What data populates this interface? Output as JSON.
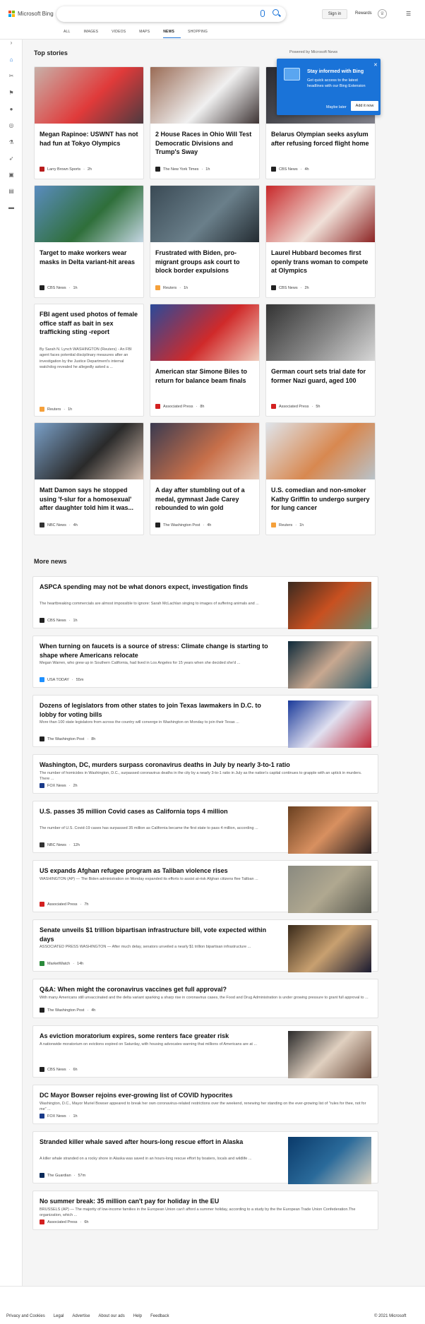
{
  "header": {
    "logo_text": "Microsoft Bing",
    "signin": "Sign in",
    "rewards": "Rewards",
    "tabs": [
      "ALL",
      "IMAGES",
      "VIDEOS",
      "MAPS",
      "NEWS",
      "SHOPPING"
    ],
    "active_tab": "NEWS"
  },
  "top_stories": {
    "title": "Top stories",
    "powered": "Powered by Microsoft News"
  },
  "popup": {
    "title": "Stay informed with Bing",
    "body": "Get quick access to the latest headlines with our Bing Extension",
    "later": "Maybe later",
    "add": "Add it now"
  },
  "cards": [
    {
      "title": "Megan Rapinoe: USWNT has not had fun at Tokyo Olympics",
      "source": "Larry Brown Sports",
      "time": "2h",
      "fav_color": "#b71c1c",
      "img": [
        "#c8b0a8",
        "#e03a3a",
        "#4a3a40"
      ]
    },
    {
      "title": "2 House Races in Ohio Will Test Democratic Divisions and Trump's Sway",
      "source": "The New York Times",
      "time": "1h",
      "fav_color": "#222222",
      "img": [
        "#9a6b55",
        "#f0f0f0",
        "#3a3030"
      ]
    },
    {
      "title": "Belarus Olympian seeks asylum after refusing forced flight home",
      "source": "CBS News",
      "time": "4h",
      "fav_color": "#222222",
      "img": [
        "#2a2a30",
        "#5a5a60",
        "#80808a"
      ]
    },
    {
      "title": "Target to make workers wear masks in Delta variant-hit areas",
      "source": "CBS News",
      "time": "1h",
      "fav_color": "#222222",
      "img": [
        "#5a8cbf",
        "#2f6f3a",
        "#c7d8e6"
      ]
    },
    {
      "title": "Frustrated with Biden, pro-migrant groups ask court to block border expulsions",
      "source": "Reuters",
      "time": "1h",
      "fav_color": "#f5a03a",
      "img": [
        "#3a4a55",
        "#6a7f8a",
        "#222a30"
      ]
    },
    {
      "title": "Laurel Hubbard becomes first openly trans woman to compete at Olympics",
      "source": "CBS News",
      "time": "2h",
      "fav_color": "#222222",
      "img": [
        "#c8282a",
        "#f0e0d8",
        "#8a2020"
      ]
    },
    {
      "title": "American star Simone Biles to return for balance beam finals",
      "source": "Associated Press",
      "time": "8h",
      "fav_color": "#d32020",
      "img": [
        "#2a4a9a",
        "#d02a2a",
        "#f0d0c0"
      ]
    },
    {
      "title": "German court sets trial date for former Nazi guard, aged 100",
      "source": "Associated Press",
      "time": "5h",
      "fav_color": "#d32020",
      "img": [
        "#333333",
        "#888888",
        "#d8d8d8"
      ]
    },
    {
      "title": "Matt Damon says he stopped using 'f-slur for a homosexual' after daughter told him it was...",
      "source": "NBC News",
      "time": "4h",
      "fav_color": "#333333",
      "img": [
        "#7aa0c8",
        "#2a2a2a",
        "#d8c0b0"
      ]
    },
    {
      "title": "A day after stumbling out of a medal, gymnast Jade Carey rebounded to win gold",
      "source": "The Washington Post",
      "time": "4h",
      "fav_color": "#222222",
      "img": [
        "#3a3a50",
        "#c8704a",
        "#e8d0c0"
      ]
    },
    {
      "title": "U.S. comedian and non-smoker Kathy Griffin to undergo surgery for lung cancer",
      "source": "Reuters",
      "time": "1h",
      "fav_color": "#f5a03a",
      "img": [
        "#dfe4ea",
        "#d88850",
        "#b8c4cc"
      ]
    }
  ],
  "text_card": {
    "title": "FBI agent used photos of female office staff as bait in sex trafficking sting -report",
    "snippet": "By Sarah N. Lynch WASHINGTON (Reuters) - An FBI agent faces potential disciplinary measures after an investigation by the Justice Department's internal watchdog revealed he allegedly asked a ...",
    "source": "Reuters",
    "time": "1h",
    "fav_color": "#f5a03a"
  },
  "more_news": {
    "title": "More news",
    "items": [
      {
        "title": "ASPCA spending may not be what donors expect, investigation finds",
        "snippet": "The heartbreaking commercials are almost impossible to ignore: Sarah McLachlan singing to images of suffering animals and ...",
        "source": "CBS News",
        "time": "1h",
        "fav_color": "#222222",
        "img": [
          "#3a2a20",
          "#c85020",
          "#6a8a70"
        ]
      },
      {
        "title": "When turning on faucets is a source of stress: Climate change is starting to shape where Americans relocate",
        "snippet": "Megan Warren, who grew up in Southern California, had lived in Los Angeles for 15 years when she decided she'd ...",
        "source": "USA TODAY",
        "time": "55m",
        "fav_color": "#1e90ff",
        "img": [
          "#0e2a3a",
          "#c8a890",
          "#2a5a6a"
        ]
      },
      {
        "title": "Dozens of legislators from other states to join Texas lawmakers in D.C. to lobby for voting bills",
        "snippet": "More than 100 state legislators from across the country will converge in Washington on Monday to join their Texas ...",
        "source": "The Washington Post",
        "time": "8h",
        "fav_color": "#222222",
        "img": [
          "#1a3a9a",
          "#e0e0f0",
          "#c02a3a"
        ]
      },
      {
        "title": "Washington, DC, murders surpass coronavirus deaths in July by nearly 3-to-1 ratio",
        "snippet": "The number of homicides in Washington, D.C., surpassed coronavirus deaths in the city by a nearly 3-to-1 ratio in July as the nation's capital continues to grapple with an uptick in murders. There ...",
        "source": "FOX News",
        "time": "2h",
        "fav_color": "#1a3a8a"
      },
      {
        "title": "U.S. passes 35 million Covid cases as California tops 4 million",
        "snippet": "The number of U.S. Covid-19 cases has surpassed 35 million as California became the first state to pass 4 million, according ...",
        "source": "NBC News",
        "time": "12h",
        "fav_color": "#333333",
        "img": [
          "#6a4020",
          "#d89060",
          "#2a2020"
        ]
      },
      {
        "title": "US expands Afghan refugee program as Taliban violence rises",
        "snippet": "WASHINGTON (AP) — The Biden administration on Monday expanded its efforts to assist at-risk Afghan citizens flee Taliban ...",
        "source": "Associated Press",
        "time": "7h",
        "fav_color": "#d32020",
        "img": [
          "#8a8a80",
          "#b0a890",
          "#5a5a50"
        ]
      },
      {
        "title": "Senate unveils $1 trillion bipartisan infrastructure bill, vote expected within days",
        "snippet": "ASSOCIATED PRESS WASHINGTON — After much delay, senators unveiled a nearly $1 trillion bipartisan infrastructure ...",
        "source": "MarketWatch",
        "time": "14h",
        "fav_color": "#2a8a3a",
        "img": [
          "#3a2a1a",
          "#c8a070",
          "#1a1a30"
        ]
      },
      {
        "title": "Q&A: When might the coronavirus vaccines get full approval?",
        "snippet": "With many Americans still unvaccinated and the delta variant sparking a sharp rise in coronavirus cases, the Food and Drug Administration is under growing pressure to grant full approval to ...",
        "source": "The Washington Post",
        "time": "4h",
        "fav_color": "#222222"
      },
      {
        "title": "As eviction moratorium expires, some renters face greater risk",
        "snippet": "A nationwide moratorium on evictions expired on Saturday, with housing advocates warning that millions of Americans are at ...",
        "source": "CBS News",
        "time": "6h",
        "fav_color": "#222222",
        "img": [
          "#2a2a2a",
          "#e0d0c0",
          "#6a4a3a"
        ]
      },
      {
        "title": "DC Mayor Bowser rejoins ever-growing list of COVID hypocrites",
        "snippet": "Washington, D.C., Mayor Muriel Bowser appeared to break her own coronavirus-related restrictions over the weekend, renewing her standing on the ever-growing list of \"rules for thee, not for me\" ...",
        "source": "FOX News",
        "time": "1h",
        "fav_color": "#1a3a8a"
      },
      {
        "title": "Stranded killer whale saved after hours-long rescue effort in Alaska",
        "snippet": "A killer whale stranded on a rocky shore in Alaska was saved in an hours-long rescue effort by boaters, locals and wildlife ...",
        "source": "The Guardian",
        "time": "57m",
        "fav_color": "#0a2a5a",
        "img": [
          "#0a3a6a",
          "#2a6a9a",
          "#d8d0c0"
        ]
      },
      {
        "title": "No summer break: 35 million can't pay for holiday in the EU",
        "snippet": "BRUSSELS (AP) — The majority of low-income families in the European Union can't afford a summer holiday, according to a study by the the European Trade Union Confederation.The organization, which ...",
        "source": "Associated Press",
        "time": "6h",
        "fav_color": "#d32020"
      }
    ]
  },
  "footer": {
    "links": [
      "Privacy and Cookies",
      "Legal",
      "Advertise",
      "About our ads",
      "Help",
      "Feedback"
    ],
    "copyright": "© 2021 Microsoft"
  }
}
